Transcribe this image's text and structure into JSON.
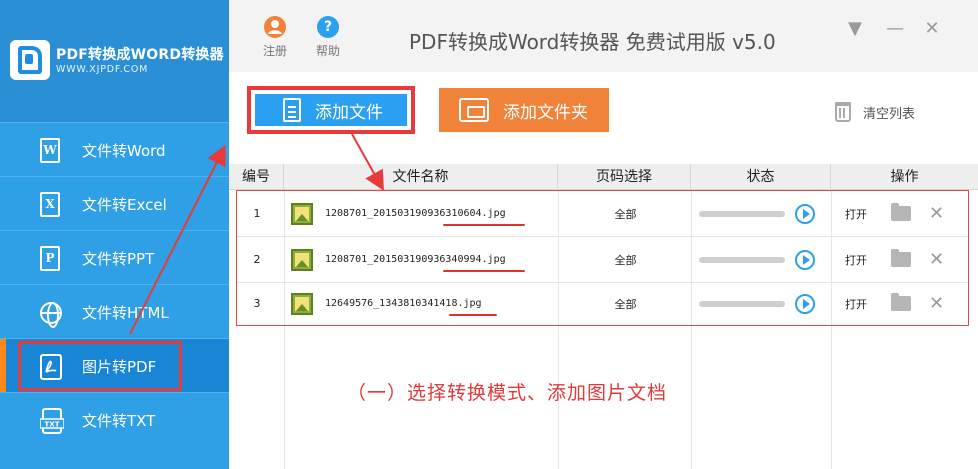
{
  "brand": {
    "title": "PDF转换成WORD转换器",
    "url": "WWW.XJPDF.COM"
  },
  "sidebar": {
    "items": [
      {
        "label": "文件转Word",
        "icon": "W"
      },
      {
        "label": "文件转Excel",
        "icon": "X"
      },
      {
        "label": "文件转PPT",
        "icon": "P"
      },
      {
        "label": "文件转HTML",
        "icon": "globe"
      },
      {
        "label": "图片转PDF",
        "icon": "pdf",
        "active": true
      },
      {
        "label": "文件转TXT",
        "icon": "TXT"
      }
    ]
  },
  "titlebar": {
    "register_label": "注册",
    "help_label": "帮助",
    "app_title": "PDF转换成Word转换器 免费试用版 v5.0",
    "register_color": "#f0823a",
    "help_color": "#2b9ff0"
  },
  "toolbar": {
    "add_file_label": "添加文件",
    "add_folder_label": "添加文件夹",
    "clear_list_label": "清空列表"
  },
  "table": {
    "headers": [
      "编号",
      "文件名称",
      "页码选择",
      "状态",
      "操作"
    ],
    "rows": [
      {
        "num": "1",
        "filename_base": "1208701_20150319093631060",
        "filename_tail": "4.jpg",
        "pages": "全部",
        "action": "打开"
      },
      {
        "num": "2",
        "filename_base": "1208701_20150319093634099",
        "filename_tail": "4.jpg",
        "pages": "全部",
        "action": "打开"
      },
      {
        "num": "3",
        "filename_base": "12649576_134381034141",
        "filename_tail": "8.jpg",
        "pages": "全部",
        "action": "打开"
      }
    ]
  },
  "caption": "（一）选择转换模式、添加图片文档",
  "colors": {
    "sidebar": "#2f9fe6",
    "accent_blue": "#2b9ff0",
    "accent_orange": "#f0823a",
    "annotation_red": "#e83a3a"
  }
}
